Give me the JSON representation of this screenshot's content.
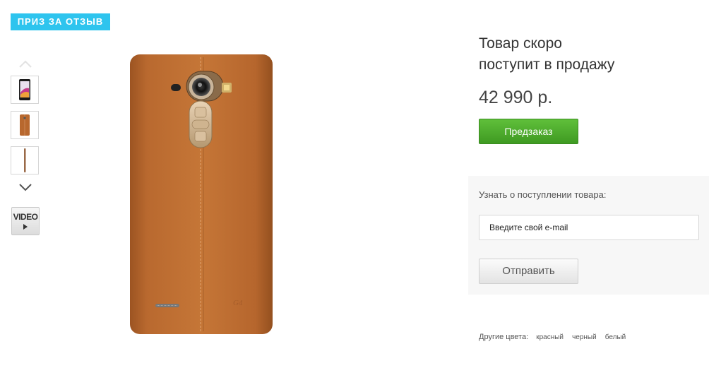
{
  "badge": {
    "label": "ПРИЗ ЗА ОТЗЫВ"
  },
  "gallery": {
    "thumbnails": [
      {
        "icon": "phone-front-thumbnail"
      },
      {
        "icon": "phone-back-thumbnail"
      },
      {
        "icon": "phone-side-thumbnail"
      }
    ],
    "video_label": "VIDEO"
  },
  "product": {
    "status_line1": "Товар скоро",
    "status_line2": "поступит в продажу",
    "price": "42 990 р.",
    "preorder_label": "Предзаказ",
    "accent_color": "#4aaa2c",
    "body_color": "#b8682e"
  },
  "notify": {
    "label": "Узнать о поступлении товара:",
    "email_placeholder": "Введите свой e-mail",
    "submit_label": "Отправить"
  },
  "other_colors": {
    "label": "Другие цвета:",
    "items": [
      "красный",
      "черный",
      "белый"
    ]
  }
}
